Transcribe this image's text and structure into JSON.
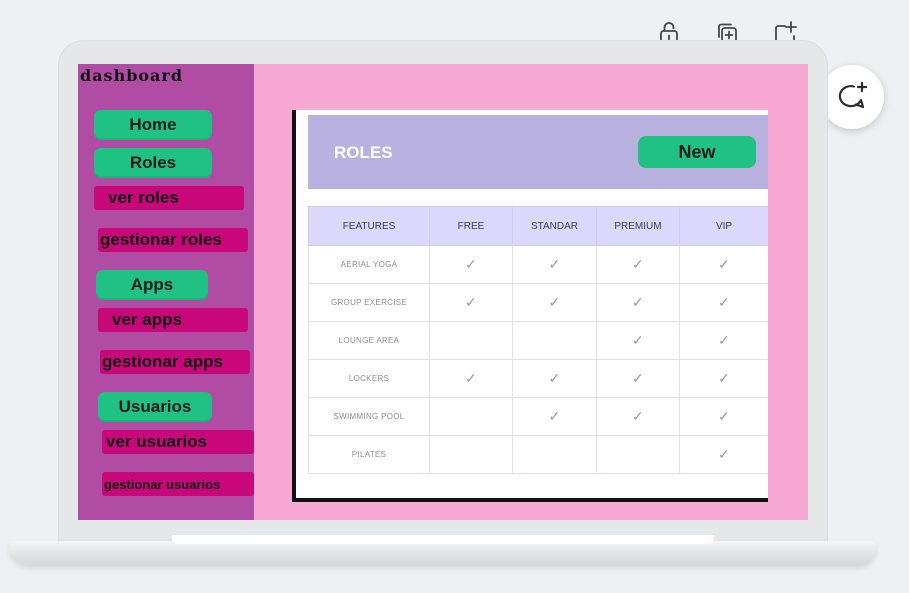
{
  "sidebar": {
    "brand": "dashboard",
    "items": [
      {
        "type": "main",
        "label": "Home"
      },
      {
        "type": "main",
        "label": "Roles"
      },
      {
        "type": "sub",
        "label": "ver roles"
      },
      {
        "type": "sub",
        "label": "gestionar roles"
      },
      {
        "type": "main",
        "label": "Apps"
      },
      {
        "type": "sub",
        "label": "ver apps"
      },
      {
        "type": "sub",
        "label": "gestionar apps"
      },
      {
        "type": "main",
        "label": "Usuarios"
      },
      {
        "type": "sub",
        "label": "ver usuarios"
      },
      {
        "type": "sub",
        "label": "gestionar usuarios"
      }
    ]
  },
  "roles_card": {
    "title": "ROLES",
    "new_label": "New",
    "columns": [
      "FEATURES",
      "FREE",
      "STANDAR",
      "PREMIUM",
      "VIP"
    ],
    "check_glyph": "✓",
    "rows": [
      {
        "feature": "AERIAL YOGA",
        "checks": [
          true,
          true,
          true,
          true
        ]
      },
      {
        "feature": "GROUP EXERCISE",
        "checks": [
          true,
          true,
          true,
          true
        ]
      },
      {
        "feature": "LOUNGE AREA",
        "checks": [
          false,
          false,
          true,
          true
        ]
      },
      {
        "feature": "LOCKERS",
        "checks": [
          true,
          true,
          true,
          true
        ]
      },
      {
        "feature": "SWIMMING POOL",
        "checks": [
          false,
          true,
          true,
          true
        ]
      },
      {
        "feature": "PILATES",
        "checks": [
          false,
          false,
          false,
          true
        ]
      }
    ]
  },
  "toolbar": {
    "icons": [
      "lock-icon",
      "duplicate-icon",
      "add-page-icon",
      "add-comment-icon"
    ]
  },
  "colors": {
    "screen_bg": "#f7a9d3",
    "sidebar_bg": "#b04ca4",
    "nav_main": "#20c283",
    "nav_sub": "#c8087a",
    "card_header": "#b9b1df",
    "table_header": "#dcd8fb"
  }
}
